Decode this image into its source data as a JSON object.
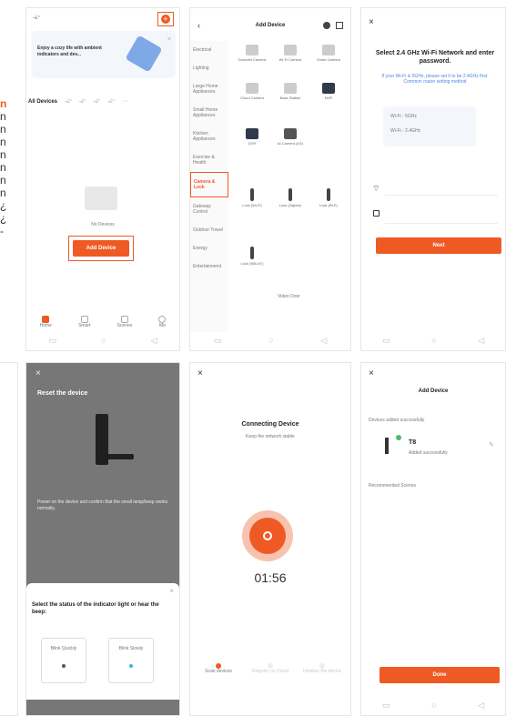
{
  "left_fragment": {
    "glyphs": [
      "n",
      "n",
      "n",
      "n",
      "n",
      "n",
      "n",
      "n",
      "¿",
      "¿",
      "-"
    ]
  },
  "panel1": {
    "home_label": "¬£°",
    "promo_text": "Enjoy a cozy life with ambient indicators and dev...",
    "tabs": [
      "All Devices",
      "¬£°",
      "¬£°",
      "¬£°",
      "¬£°"
    ],
    "empty_label": "No Devices",
    "add_button": "Add Device",
    "bottom_tabs": [
      "Home",
      "Smart",
      "Scenes",
      "Me"
    ]
  },
  "panel2": {
    "title": "Add Device",
    "sidebar": [
      "Electrical",
      "Lighting",
      "Large Home Appliances",
      "Small Home Appliances",
      "Kitchen Appliances",
      "Exercise & Health",
      "Camera & Lock",
      "Gateway Control",
      "Outdoor Travel",
      "Energy",
      "Entertainment"
    ],
    "active_sidebar": "Camera & Lock",
    "top_devices": [
      "Doorbell Camera",
      "Wi-Fi Camera",
      "Smart Camera",
      "Cloud Camera",
      "Base Station",
      "NVR",
      "DVR",
      "AI Camera (4G)"
    ],
    "lock_devices": [
      "Lock (Wi-Fi)",
      "Lock (Zigbee)",
      "Lock (BLE)",
      "Lock (NB-IoT)"
    ],
    "section_label": "Video Door"
  },
  "panel3": {
    "title": "Select 2.4 GHz Wi-Fi Network and enter password.",
    "subtitle": "If your Wi-Fi is 5GHz, please set it to be 2.4GHz first. Common router setting method",
    "wifi_list_rows": [
      "Wi-Fi - 5GHz",
      "Wi-Fi - 2.4GHz"
    ],
    "wifi_icon": "wifi-icon",
    "lock_icon": "lock-icon",
    "next_button": "Next"
  },
  "panel4": {
    "title": "Reset the device",
    "desc": "Power on the device and confirm that the small lamp/beep works normally.",
    "status_prompt": "Select the status of the indicator light or hear the beep:",
    "options": [
      "Blink Quickly",
      "Blink Slowly"
    ]
  },
  "panel5": {
    "title": "Connecting Device",
    "subtitle": "Keep the network stable",
    "timer": "01:56",
    "steps": [
      "Scan devices",
      "Register on Cloud",
      "Initialize the device"
    ]
  },
  "panel6": {
    "title": "Add Device",
    "section1": "Devices added successfully",
    "device_name": "T8",
    "device_status": "Added successfully",
    "section2": "Recommended Scenes",
    "done_button": "Done"
  },
  "colors": {
    "accent": "#ef5a24",
    "dark_panel": "#777777"
  }
}
